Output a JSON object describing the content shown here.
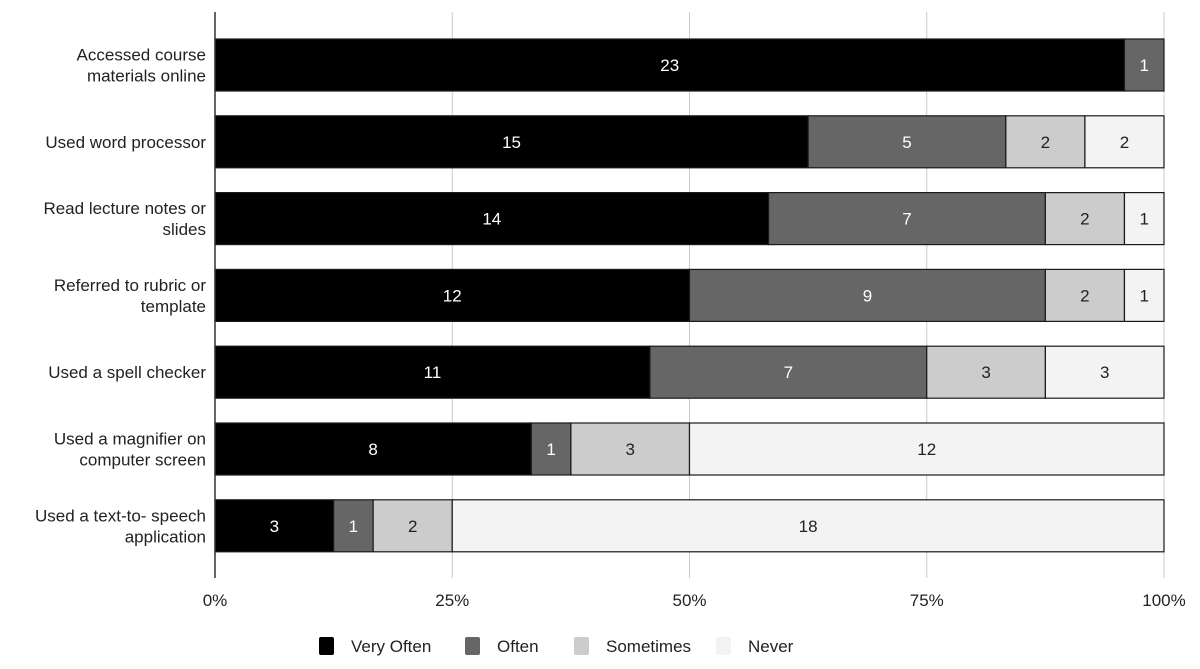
{
  "chart_data": {
    "type": "bar",
    "orientation": "horizontal",
    "stacked": "percent",
    "title": "",
    "xlabel": "",
    "ylabel": "",
    "xlim": [
      0,
      100
    ],
    "x_ticks": [
      "0%",
      "25%",
      "50%",
      "75%",
      "100%"
    ],
    "grid": true,
    "legend_position": "bottom",
    "categories": [
      [
        "Accessed course",
        "materials online"
      ],
      [
        "Used word processor"
      ],
      [
        "Read lecture notes or",
        "slides"
      ],
      [
        "Referred to rubric or",
        "template"
      ],
      [
        "Used a spell checker"
      ],
      [
        "Used a magnifier on",
        "computer screen"
      ],
      [
        "Used a text-to- speech",
        "application"
      ]
    ],
    "series": [
      {
        "name": "Very Often",
        "color": "#000000",
        "label_color": "#ffffff",
        "values": [
          23,
          15,
          14,
          12,
          11,
          8,
          3
        ]
      },
      {
        "name": "Often",
        "color": "#666666",
        "label_color": "#ffffff",
        "values": [
          1,
          5,
          7,
          9,
          7,
          1,
          1
        ]
      },
      {
        "name": "Sometimes",
        "color": "#cccccc",
        "label_color": "#222222",
        "values": [
          0,
          2,
          2,
          2,
          3,
          3,
          2
        ]
      },
      {
        "name": "Never",
        "color": "#f3f3f3",
        "label_color": "#222222",
        "values": [
          0,
          2,
          1,
          1,
          3,
          12,
          18
        ]
      }
    ]
  }
}
